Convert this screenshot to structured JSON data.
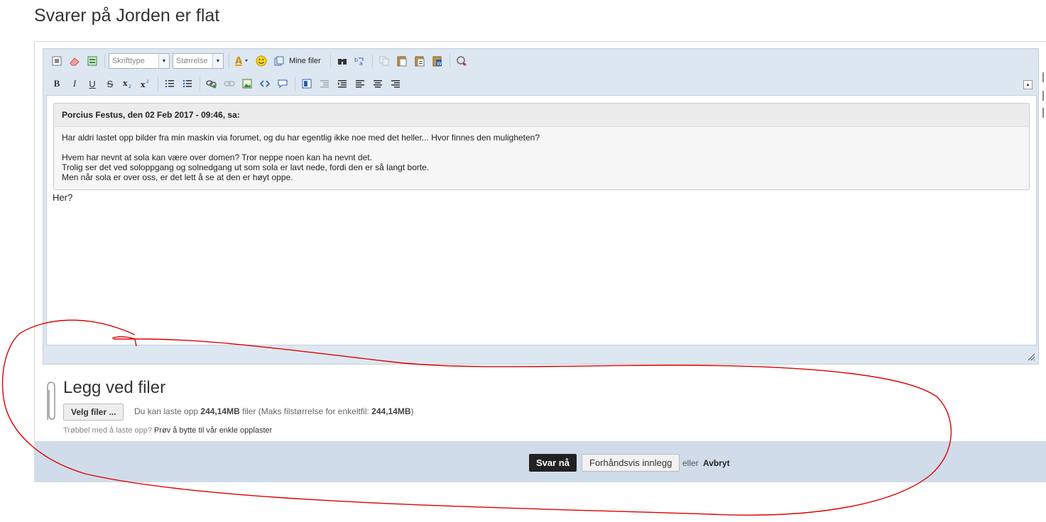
{
  "page": {
    "title": "Svarer på Jorden er flat"
  },
  "toolbar": {
    "font_combo": "Skrifttype",
    "size_combo": "Størrelse",
    "my_files": "Mine filer",
    "bold": "B",
    "italic": "I",
    "underline": "U",
    "strike": "S"
  },
  "quote": {
    "header": "Porcius Festus, den 02 Feb 2017 - 09:46, sa:",
    "lines": [
      "Har aldri lastet opp bilder fra min maskin via forumet, og du har egentlig ikke noe med det heller... Hvor finnes den muligheten?",
      "Hvem har nevnt at sola kan være over domen? Tror neppe noen kan ha nevnt det.",
      "Trolig ser det ved soloppgang og solnedgang ut som sola er lavt nede, fordi den er så langt borte.",
      "Men når sola er over oss, er det lett å se at den er høyt oppe."
    ]
  },
  "reply": {
    "text": "Her?"
  },
  "attach": {
    "title": "Legg ved filer",
    "pick_button": "Velg filer ...",
    "info_prefix": "Du kan laste opp",
    "info_size": "244,14MB",
    "info_mid": "filer (Maks filstørrelse for enkeltfil:",
    "info_max": "244,14MB",
    "info_suffix": ")",
    "trouble_text": "Trøbbel med å laste opp?",
    "trouble_link": "Prøv å bytte til vår enkle opplaster"
  },
  "actions": {
    "submit": "Svar nå",
    "preview": "Forhåndsvis innlegg",
    "or": "eller",
    "cancel": "Avbryt"
  },
  "colors": {
    "annotation": "#e00000",
    "bar": "#d0dcea",
    "primary": "#222222"
  }
}
